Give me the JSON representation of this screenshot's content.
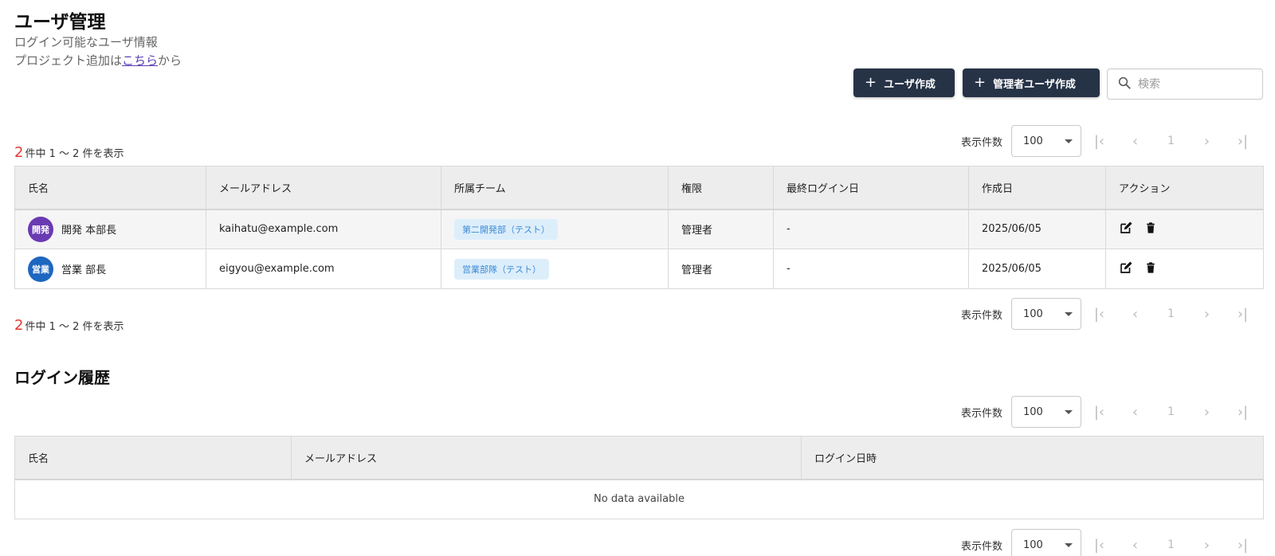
{
  "header": {
    "title": "ユーザ管理",
    "subtitle": "ログイン可能なユーザ情報",
    "project_prefix": "プロジェクト追加は",
    "project_link": "こちら",
    "project_suffix": "から"
  },
  "toolbar": {
    "create_user": "ユーザ作成",
    "create_admin": "管理者ユーザ作成",
    "search_placeholder": "検索"
  },
  "users": {
    "count_total": "2",
    "count_suffix": "件中 1 〜 2 件を表示",
    "pager": {
      "per_page_label": "表示件数",
      "per_page": "100",
      "page": "1"
    },
    "columns": [
      "氏名",
      "メールアドレス",
      "所属チーム",
      "権限",
      "最終ログイン日",
      "作成日",
      "アクション"
    ],
    "rows": [
      {
        "avatar": "開発",
        "avatar_color": "#6a3ab2",
        "name": "開発 本部長",
        "email": "kaihatu@example.com",
        "team": "第二開発部（テスト）",
        "role": "管理者",
        "last_login": "-",
        "created": "2025/06/05"
      },
      {
        "avatar": "営業",
        "avatar_color": "#1e67c0",
        "name": "営業 部長",
        "email": "eigyou@example.com",
        "team": "営業部隊（テスト）",
        "role": "管理者",
        "last_login": "-",
        "created": "2025/06/05"
      }
    ]
  },
  "history": {
    "title": "ログイン履歴",
    "columns": [
      "氏名",
      "メールアドレス",
      "ログイン日時"
    ],
    "empty": "No data available",
    "pager": {
      "per_page_label": "表示件数",
      "per_page": "100",
      "page": "1"
    }
  },
  "colors": {
    "primary_button": "#263246",
    "accent_link": "#5b3fb5",
    "count_highlight": "#e53935"
  },
  "icons": [
    "plus-icon",
    "search-icon",
    "first-page-icon",
    "prev-page-icon",
    "next-page-icon",
    "last-page-icon",
    "edit-icon",
    "trash-icon"
  ]
}
